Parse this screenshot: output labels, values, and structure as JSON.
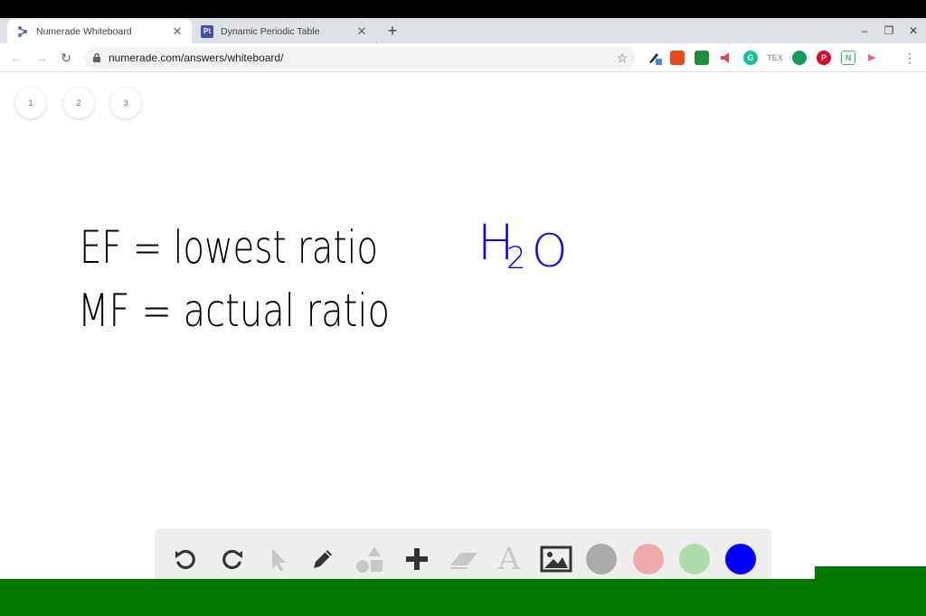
{
  "browser": {
    "tabs": [
      {
        "title": "Numerade Whiteboard",
        "active": true,
        "icon": "numerade-logo-icon"
      },
      {
        "title": "Dynamic Periodic Table",
        "active": false,
        "icon": "pt-logo-icon",
        "icon_text": "Pt"
      }
    ],
    "close_glyph": "✕",
    "new_tab_glyph": "+",
    "url": "numerade.com/answers/whiteboard/",
    "window_controls": {
      "minimize": "–",
      "restore": "❐",
      "close": "✕"
    },
    "nav": {
      "back": "←",
      "forward": "→",
      "reload": "↻"
    },
    "extensions": [
      {
        "name": "pen-extension-icon",
        "color": "#4285f4"
      },
      {
        "name": "office-extension-icon",
        "color": "#e64a19"
      },
      {
        "name": "classroom-extension-icon",
        "color": "#1e8e3e"
      },
      {
        "name": "speaker-extension-icon",
        "color": "#e8453c"
      },
      {
        "name": "grammarly-extension-icon",
        "color": "#15c39a"
      },
      {
        "name": "tex-extension-icon",
        "color": "#9e9e9e"
      },
      {
        "name": "hangouts-extension-icon",
        "color": "#0f9d58"
      },
      {
        "name": "pinterest-extension-icon",
        "color": "#e60023"
      },
      {
        "name": "notes-extension-icon",
        "color": "#3cba54"
      },
      {
        "name": "arrow-extension-icon",
        "color": "#f06292"
      }
    ]
  },
  "whiteboard": {
    "pages": [
      "1",
      "2",
      "3"
    ],
    "handwriting": {
      "line1": "EF = lowest ratio",
      "line2": "MF = actual ratio",
      "formula_main": "H",
      "formula_sub": "2",
      "formula_end": "O"
    },
    "ink_colors": {
      "black": "#000000",
      "blue": "#1400ff"
    }
  },
  "toolbar": {
    "tools": [
      "undo-icon",
      "redo-icon",
      "pointer-icon",
      "pen-icon",
      "shapes-icon",
      "add-icon",
      "eraser-icon",
      "text-icon",
      "image-icon"
    ],
    "colors": [
      "#aaaaaa",
      "#eeaaaa",
      "#aaddaa",
      "#0000ff"
    ],
    "text_tool_glyph": "A"
  },
  "theme": {
    "accent": "#4a6ee0",
    "bottom_bar": "#007a00"
  }
}
